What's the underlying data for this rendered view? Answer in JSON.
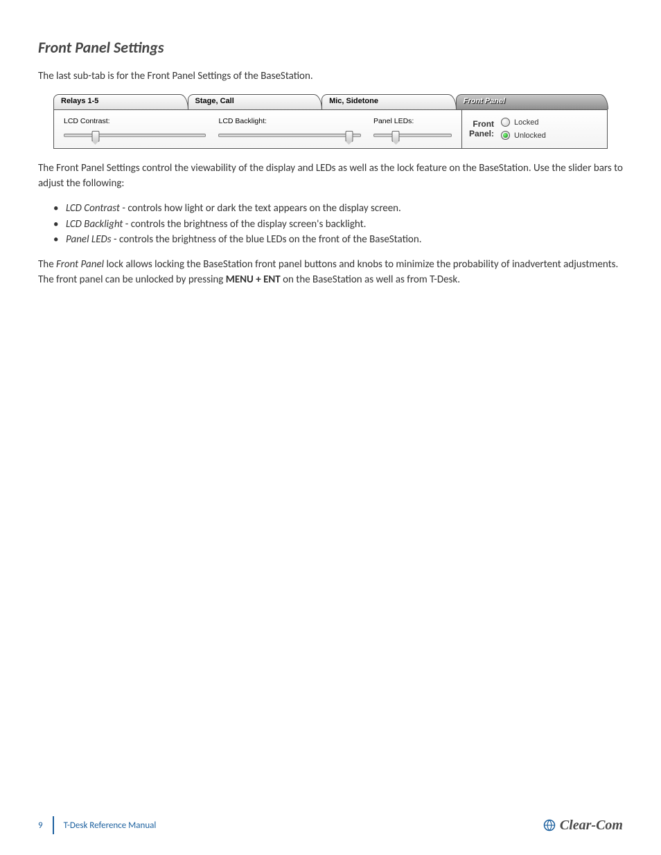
{
  "heading": "Front Panel Settings",
  "intro": "The last sub-tab is for the Front Panel Settings of the BaseStation.",
  "ui": {
    "tabs": [
      "Relays 1-5",
      "Stage, Call",
      "Mic, Sidetone",
      "Front Panel"
    ],
    "sliders": [
      {
        "label": "LCD Contrast:",
        "pos": 22
      },
      {
        "label": "LCD Backlight:",
        "pos": 92
      },
      {
        "label": "Panel LEDs:",
        "pos": 28
      }
    ],
    "lock": {
      "title_line1": "Front",
      "title_line2": "Panel:",
      "opt_locked": "Locked",
      "opt_unlocked": "Unlocked"
    }
  },
  "para2": "The Front Panel Settings control the viewability of the display and LEDs as well as the lock feature on the BaseStation.  Use the slider bars to adjust the following:",
  "bullets": [
    {
      "term": "LCD Contrast",
      "desc": " - controls how light or dark the text appears on the display screen."
    },
    {
      "term": "LCD Backlight",
      "desc": " - controls the brightness of the display screen's backlight."
    },
    {
      "term": "Panel LEDs",
      "desc": " - controls the brightness of the blue LEDs on the front of the BaseStation."
    }
  ],
  "para3_pre": "The ",
  "para3_italic": "Front Panel",
  "para3_mid": " lock allows locking the BaseStation front panel buttons and knobs to minimize the probability of inadvertent adjustments.  The front panel can be unlocked by pressing ",
  "para3_bold": "MENU + ENT",
  "para3_post": " on the BaseStation as well as from T-Desk.",
  "footer": {
    "page": "9",
    "doc": "T-Desk Reference Manual",
    "brand": "Clear-Com"
  }
}
